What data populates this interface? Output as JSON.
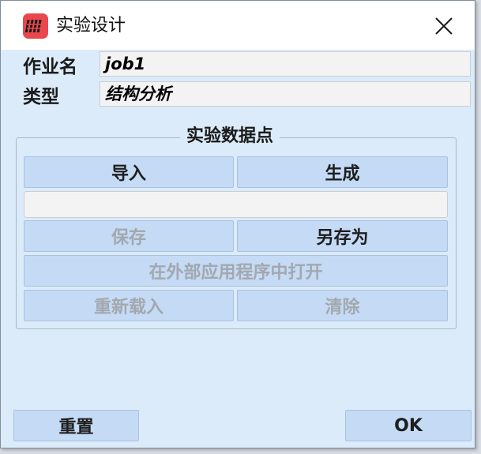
{
  "window": {
    "title": "实验设计",
    "icon": "app-logo-icon",
    "close_icon": "close-icon"
  },
  "fields": {
    "job_name_label": "作业名",
    "job_name_value": "job1",
    "type_label": "类型",
    "type_value": "结构分析"
  },
  "group": {
    "title": "实验数据点",
    "import_label": "导入",
    "generate_label": "生成",
    "path_value": "",
    "save_label": "保存",
    "save_as_label": "另存为",
    "open_external_label": "在外部应用程序中打开",
    "reload_label": "重新载入",
    "clear_label": "清除"
  },
  "footer": {
    "reset_label": "重置",
    "ok_label": "OK"
  },
  "colors": {
    "dialog_bg": "#dcebf9",
    "button_bg": "#c4daf5",
    "app_icon": "#e9474c",
    "disabled_text": "#a3a8ae"
  }
}
